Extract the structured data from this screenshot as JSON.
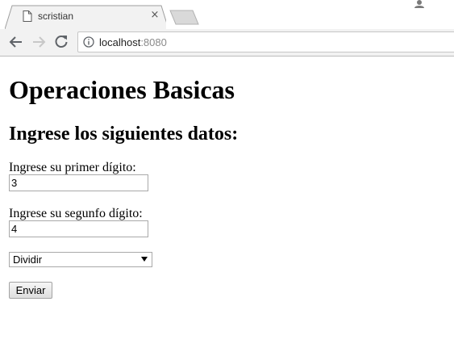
{
  "browser": {
    "tab_title": "scristian",
    "tab_close": "×",
    "url_host": "localhost",
    "url_port": ":8080"
  },
  "page": {
    "title": "Operaciones Basicas",
    "subtitle": "Ingrese los siguientes datos:",
    "first_label": "Ingrese su primer dígito:",
    "first_value": "3",
    "second_label": "Ingrese su segunfo dígito:",
    "second_value": "4",
    "operation_selected": "Dividir",
    "submit_label": "Enviar"
  },
  "icons": {
    "favicon": "page-icon",
    "back": "arrow-left-icon",
    "forward": "arrow-right-icon",
    "reload": "reload-icon",
    "info": "info-icon",
    "profile": "profile-icon",
    "dropdown": "chevron-down-icon"
  }
}
